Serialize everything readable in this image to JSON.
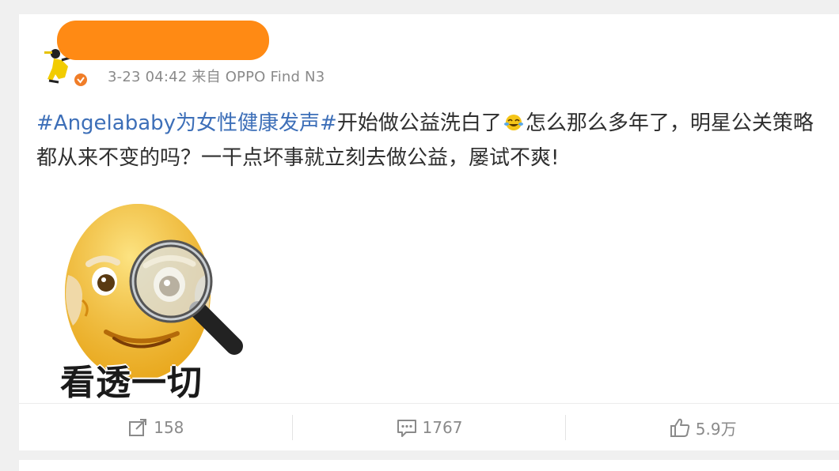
{
  "post": {
    "meta": "3-23 04:42 来自 OPPO Find N3",
    "hashtag": "#Angelababy为女性健康发声#",
    "text_part1": "开始做公益洗白了",
    "text_part2": "怎么那么多年了，明星公关策略都从来不变的吗？一干点坏事就立刻去做公益，屡试不爽!",
    "sticker_caption": "看透一切",
    "inline_emoji_icon": "laugh-cry-emoji-icon",
    "sticker_icon": "old-man-magnifier-emoji-icon"
  },
  "actions": {
    "repost_count": "158",
    "comment_count": "1767",
    "like_count": "5.9万"
  },
  "colors": {
    "hashtag": "#3d6fb8",
    "redaction": "#ff8a14",
    "verified_badge": "#f07d28"
  }
}
